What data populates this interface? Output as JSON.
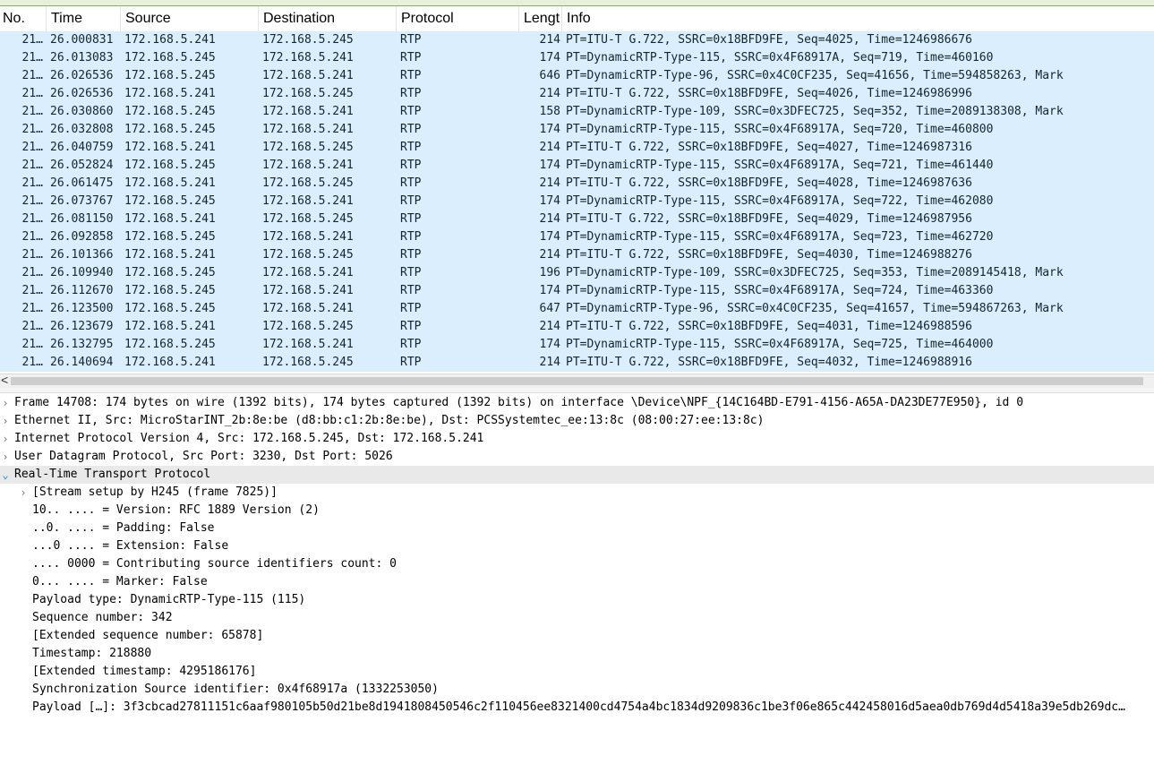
{
  "window": {
    "title": ""
  },
  "columns": {
    "no": "No.",
    "time": "Time",
    "source": "Source",
    "destination": "Destination",
    "protocol": "Protocol",
    "length": "Lengt",
    "info": "Info"
  },
  "packets": [
    {
      "no": "21…",
      "time": "26.000831",
      "src": "172.168.5.241",
      "dst": "172.168.5.245",
      "proto": "RTP",
      "len": "214",
      "info": "PT=ITU-T G.722, SSRC=0x18BFD9FE, Seq=4025, Time=1246986676"
    },
    {
      "no": "21…",
      "time": "26.013083",
      "src": "172.168.5.245",
      "dst": "172.168.5.241",
      "proto": "RTP",
      "len": "174",
      "info": "PT=DynamicRTP-Type-115, SSRC=0x4F68917A, Seq=719, Time=460160"
    },
    {
      "no": "21…",
      "time": "26.026536",
      "src": "172.168.5.245",
      "dst": "172.168.5.241",
      "proto": "RTP",
      "len": "646",
      "info": "PT=DynamicRTP-Type-96, SSRC=0x4C0CF235, Seq=41656, Time=594858263, Mark"
    },
    {
      "no": "21…",
      "time": "26.026536",
      "src": "172.168.5.241",
      "dst": "172.168.5.245",
      "proto": "RTP",
      "len": "214",
      "info": "PT=ITU-T G.722, SSRC=0x18BFD9FE, Seq=4026, Time=1246986996"
    },
    {
      "no": "21…",
      "time": "26.030860",
      "src": "172.168.5.245",
      "dst": "172.168.5.241",
      "proto": "RTP",
      "len": "158",
      "info": "PT=DynamicRTP-Type-109, SSRC=0x3DFEC725, Seq=352, Time=2089138308, Mark"
    },
    {
      "no": "21…",
      "time": "26.032808",
      "src": "172.168.5.245",
      "dst": "172.168.5.241",
      "proto": "RTP",
      "len": "174",
      "info": "PT=DynamicRTP-Type-115, SSRC=0x4F68917A, Seq=720, Time=460800"
    },
    {
      "no": "21…",
      "time": "26.040759",
      "src": "172.168.5.241",
      "dst": "172.168.5.245",
      "proto": "RTP",
      "len": "214",
      "info": "PT=ITU-T G.722, SSRC=0x18BFD9FE, Seq=4027, Time=1246987316"
    },
    {
      "no": "21…",
      "time": "26.052824",
      "src": "172.168.5.245",
      "dst": "172.168.5.241",
      "proto": "RTP",
      "len": "174",
      "info": "PT=DynamicRTP-Type-115, SSRC=0x4F68917A, Seq=721, Time=461440"
    },
    {
      "no": "21…",
      "time": "26.061475",
      "src": "172.168.5.241",
      "dst": "172.168.5.245",
      "proto": "RTP",
      "len": "214",
      "info": "PT=ITU-T G.722, SSRC=0x18BFD9FE, Seq=4028, Time=1246987636"
    },
    {
      "no": "21…",
      "time": "26.073767",
      "src": "172.168.5.245",
      "dst": "172.168.5.241",
      "proto": "RTP",
      "len": "174",
      "info": "PT=DynamicRTP-Type-115, SSRC=0x4F68917A, Seq=722, Time=462080"
    },
    {
      "no": "21…",
      "time": "26.081150",
      "src": "172.168.5.241",
      "dst": "172.168.5.245",
      "proto": "RTP",
      "len": "214",
      "info": "PT=ITU-T G.722, SSRC=0x18BFD9FE, Seq=4029, Time=1246987956"
    },
    {
      "no": "21…",
      "time": "26.092858",
      "src": "172.168.5.245",
      "dst": "172.168.5.241",
      "proto": "RTP",
      "len": "174",
      "info": "PT=DynamicRTP-Type-115, SSRC=0x4F68917A, Seq=723, Time=462720"
    },
    {
      "no": "21…",
      "time": "26.101366",
      "src": "172.168.5.241",
      "dst": "172.168.5.245",
      "proto": "RTP",
      "len": "214",
      "info": "PT=ITU-T G.722, SSRC=0x18BFD9FE, Seq=4030, Time=1246988276"
    },
    {
      "no": "21…",
      "time": "26.109940",
      "src": "172.168.5.245",
      "dst": "172.168.5.241",
      "proto": "RTP",
      "len": "196",
      "info": "PT=DynamicRTP-Type-109, SSRC=0x3DFEC725, Seq=353, Time=2089145418, Mark"
    },
    {
      "no": "21…",
      "time": "26.112670",
      "src": "172.168.5.245",
      "dst": "172.168.5.241",
      "proto": "RTP",
      "len": "174",
      "info": "PT=DynamicRTP-Type-115, SSRC=0x4F68917A, Seq=724, Time=463360"
    },
    {
      "no": "21…",
      "time": "26.123500",
      "src": "172.168.5.245",
      "dst": "172.168.5.241",
      "proto": "RTP",
      "len": "647",
      "info": "PT=DynamicRTP-Type-96, SSRC=0x4C0CF235, Seq=41657, Time=594867263, Mark"
    },
    {
      "no": "21…",
      "time": "26.123679",
      "src": "172.168.5.241",
      "dst": "172.168.5.245",
      "proto": "RTP",
      "len": "214",
      "info": "PT=ITU-T G.722, SSRC=0x18BFD9FE, Seq=4031, Time=1246988596"
    },
    {
      "no": "21…",
      "time": "26.132795",
      "src": "172.168.5.245",
      "dst": "172.168.5.241",
      "proto": "RTP",
      "len": "174",
      "info": "PT=DynamicRTP-Type-115, SSRC=0x4F68917A, Seq=725, Time=464000"
    },
    {
      "no": "21…",
      "time": "26.140694",
      "src": "172.168.5.241",
      "dst": "172.168.5.245",
      "proto": "RTP",
      "len": "214",
      "info": "PT=ITU-T G.722, SSRC=0x18BFD9FE, Seq=4032, Time=1246988916"
    }
  ],
  "scrollbar": {
    "left_arrow": "<"
  },
  "details": [
    {
      "text": "Frame 14708: 174 bytes on wire (1392 bits), 174 bytes captured (1392 bits) on interface \\Device\\NPF_{14C164BD-E791-4156-A65A-DA23DE77E950}, id 0",
      "level": 0,
      "arrow": "collapsed",
      "selected": false
    },
    {
      "text": "Ethernet II, Src: MicroStarINT_2b:8e:be (d8:bb:c1:2b:8e:be), Dst: PCSSystemtec_ee:13:8c (08:00:27:ee:13:8c)",
      "level": 0,
      "arrow": "collapsed",
      "selected": false
    },
    {
      "text": "Internet Protocol Version 4, Src: 172.168.5.245, Dst: 172.168.5.241",
      "level": 0,
      "arrow": "collapsed",
      "selected": false
    },
    {
      "text": "User Datagram Protocol, Src Port: 3230, Dst Port: 5026",
      "level": 0,
      "arrow": "collapsed",
      "selected": false
    },
    {
      "text": "Real-Time Transport Protocol",
      "level": 0,
      "arrow": "expanded",
      "selected": true
    },
    {
      "text": "[Stream setup by H245 (frame 7825)]",
      "level": 1,
      "arrow": "collapsed",
      "selected": false
    },
    {
      "text": "10.. .... = Version: RFC 1889 Version (2)",
      "level": 1,
      "arrow": "none",
      "selected": false
    },
    {
      "text": "..0. .... = Padding: False",
      "level": 1,
      "arrow": "none",
      "selected": false
    },
    {
      "text": "...0 .... = Extension: False",
      "level": 1,
      "arrow": "none",
      "selected": false
    },
    {
      "text": ".... 0000 = Contributing source identifiers count: 0",
      "level": 1,
      "arrow": "none",
      "selected": false
    },
    {
      "text": "0... .... = Marker: False",
      "level": 1,
      "arrow": "none",
      "selected": false
    },
    {
      "text": "Payload type: DynamicRTP-Type-115 (115)",
      "level": 1,
      "arrow": "none",
      "selected": false
    },
    {
      "text": "Sequence number: 342",
      "level": 1,
      "arrow": "none",
      "selected": false
    },
    {
      "text": "[Extended sequence number: 65878]",
      "level": 1,
      "arrow": "none",
      "selected": false
    },
    {
      "text": "Timestamp: 218880",
      "level": 1,
      "arrow": "none",
      "selected": false
    },
    {
      "text": "[Extended timestamp: 4295186176]",
      "level": 1,
      "arrow": "none",
      "selected": false
    },
    {
      "text": "Synchronization Source identifier: 0x4f68917a (1332253050)",
      "level": 1,
      "arrow": "none",
      "selected": false
    },
    {
      "text": "Payload […]: 3f3cbcad27811151c6aaf980105b50d21be8d1941808450546c2f110456ee8321400cd4754a4bc1834d9209836c1be3f06e865c442458016d5aea0db769d4d5418a39e5db269dc…",
      "level": 1,
      "arrow": "none",
      "selected": false
    }
  ],
  "colors": {
    "row_bg": "#daeefd",
    "selected_detail_bg": "#e9e9e9",
    "expanded_arrow": "#1e88e5"
  }
}
